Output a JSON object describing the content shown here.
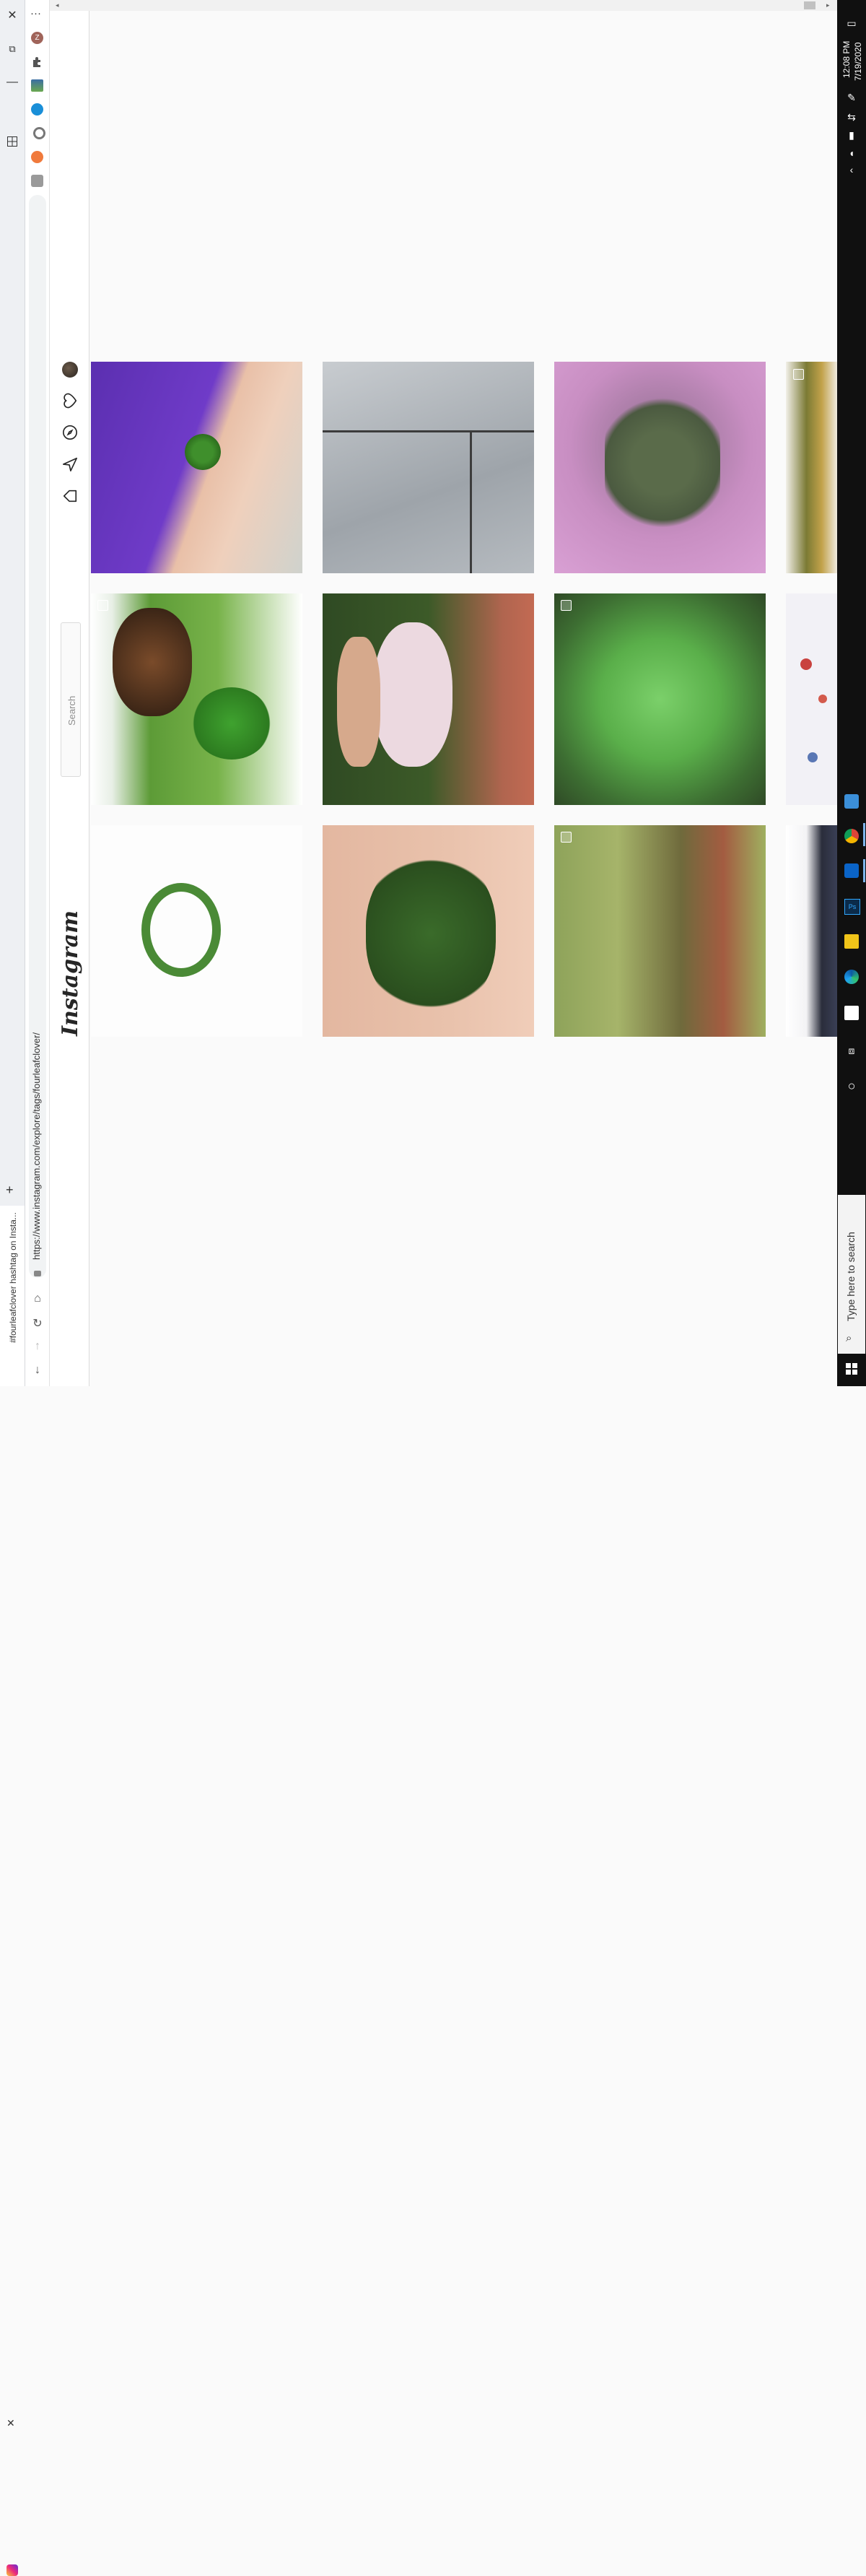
{
  "browser": {
    "tab_title": "#fourleafclover hashtag on Insta...",
    "url": "https://www.instagram.com/explore/tags/fourleafclover/",
    "menu_label": "···"
  },
  "instagram": {
    "logo": "Instagram",
    "search_placeholder": "Search",
    "nav_icons": [
      "home-icon",
      "direct-icon",
      "explore-icon",
      "activity-heart-icon",
      "profile-avatar"
    ],
    "grid": [
      {
        "row": 1,
        "col": 1,
        "subject": "child in purple dress holding four-leaf clover",
        "multi": false
      },
      {
        "row": 1,
        "col": 2,
        "subject": "grey marble tile",
        "multi": false
      },
      {
        "row": 1,
        "col": 3,
        "subject": "four-leaf clover on pink sparkle background",
        "multi": false
      },
      {
        "row": 1,
        "col": 4,
        "subject": "clover resin jewelry",
        "multi": true
      },
      {
        "row": 2,
        "col": 1,
        "subject": "dog with clover",
        "multi": true
      },
      {
        "row": 2,
        "col": 2,
        "subject": "woman wearing face mask",
        "multi": false
      },
      {
        "row": 2,
        "col": 3,
        "subject": "clover patch",
        "multi": true
      },
      {
        "row": 2,
        "col": 4,
        "subject": "floral fabric",
        "multi": false
      },
      {
        "row": 3,
        "col": 1,
        "subject": "clover wreath on white",
        "multi": false
      },
      {
        "row": 3,
        "col": 2,
        "subject": "four-leaf clover in palm",
        "multi": false
      },
      {
        "row": 3,
        "col": 3,
        "subject": "camouflage bark",
        "multi": true
      },
      {
        "row": 3,
        "col": 4,
        "subject": "dark portrait",
        "multi": false
      }
    ]
  },
  "taskbar": {
    "time": "12:08 PM",
    "date": "7/19/2020",
    "search_placeholder": "Type here to search"
  }
}
